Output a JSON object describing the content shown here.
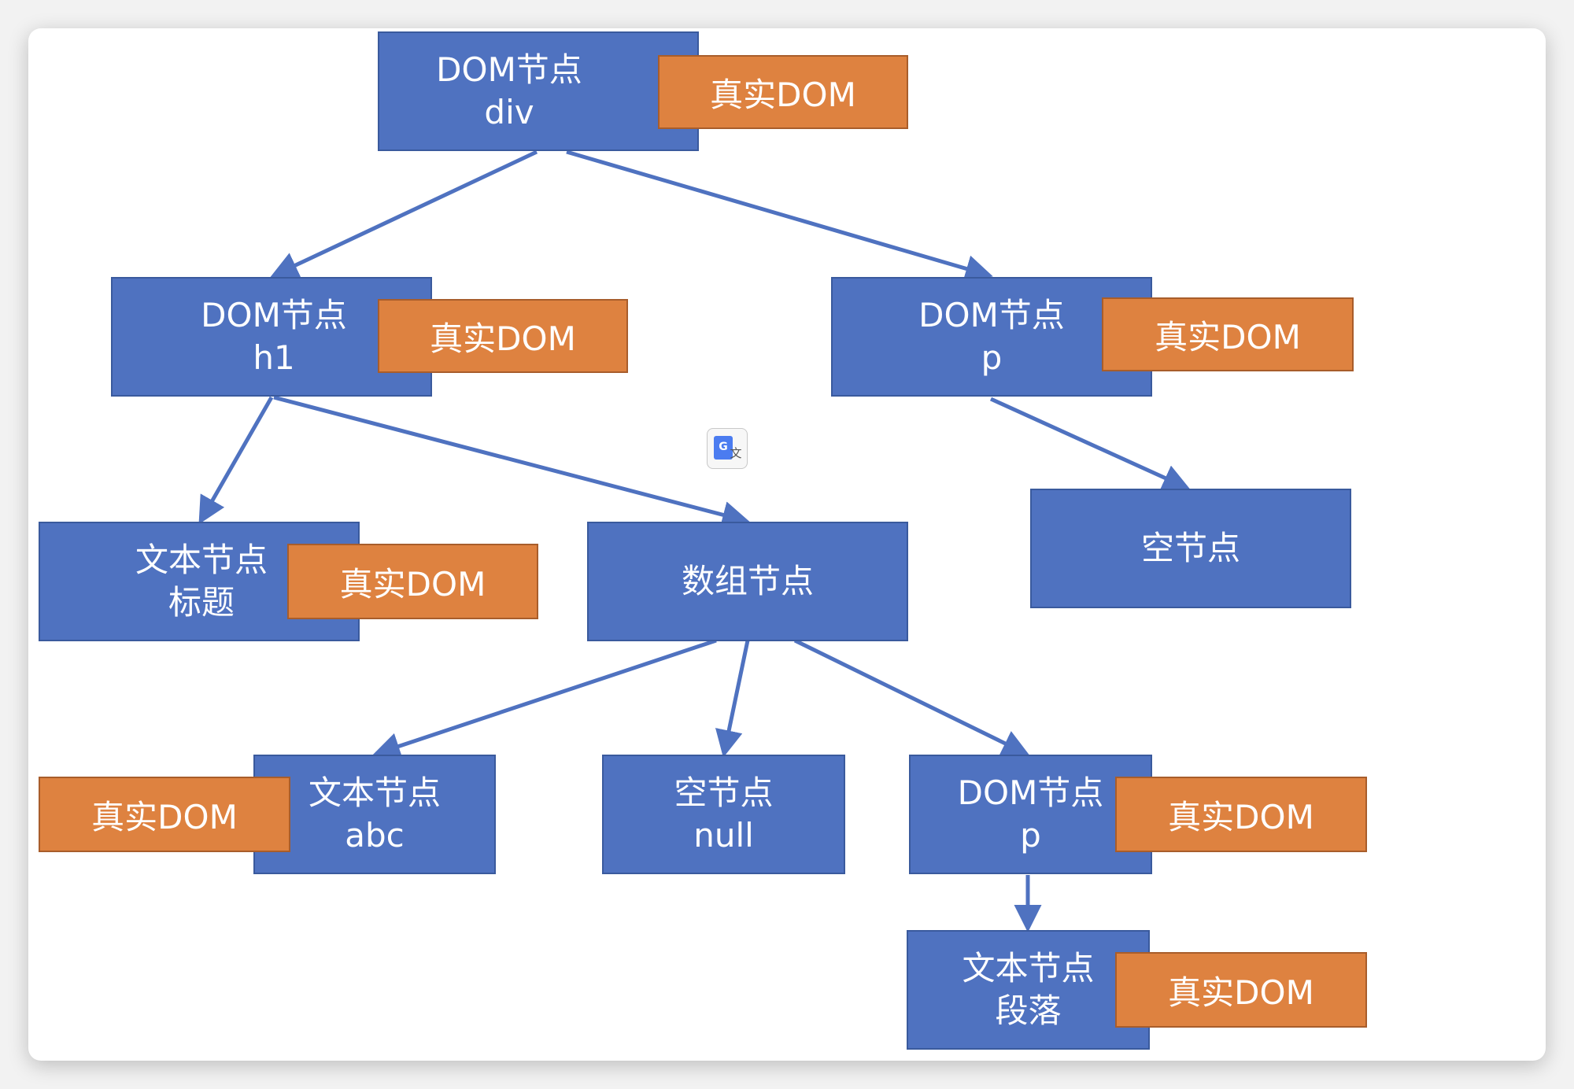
{
  "diagram": {
    "nodes": {
      "div": {
        "line1": "DOM节点",
        "line2": "div",
        "tag": "真实DOM"
      },
      "h1": {
        "line1": "DOM节点",
        "line2": "h1",
        "tag": "真实DOM"
      },
      "p_top": {
        "line1": "DOM节点",
        "line2": "p",
        "tag": "真实DOM"
      },
      "text_title": {
        "line1": "文本节点",
        "line2": "标题",
        "tag": "真实DOM"
      },
      "array": {
        "line1": "数组节点"
      },
      "empty_top": {
        "line1": "空节点"
      },
      "text_abc": {
        "line1": "文本节点",
        "line2": "abc",
        "tag": "真实DOM"
      },
      "null_node": {
        "line1": "空节点",
        "line2": "null"
      },
      "p_bottom": {
        "line1": "DOM节点",
        "line2": "p",
        "tag": "真实DOM"
      },
      "text_para": {
        "line1": "文本节点",
        "line2": "段落",
        "tag": "真实DOM"
      }
    },
    "edges": [
      {
        "from": "div",
        "to": "h1"
      },
      {
        "from": "div",
        "to": "p_top"
      },
      {
        "from": "h1",
        "to": "text_title"
      },
      {
        "from": "h1",
        "to": "array"
      },
      {
        "from": "p_top",
        "to": "empty_top"
      },
      {
        "from": "array",
        "to": "text_abc"
      },
      {
        "from": "array",
        "to": "null_node"
      },
      {
        "from": "array",
        "to": "p_bottom"
      },
      {
        "from": "p_bottom",
        "to": "text_para"
      }
    ],
    "colors": {
      "node_fill": "#4f72c0",
      "tag_fill": "#de8240",
      "edge": "#4f72c0"
    }
  },
  "overlay": {
    "translate_icon": {
      "name": "google-translate-icon",
      "glyph_g": "G",
      "glyph_wen": "文"
    }
  }
}
